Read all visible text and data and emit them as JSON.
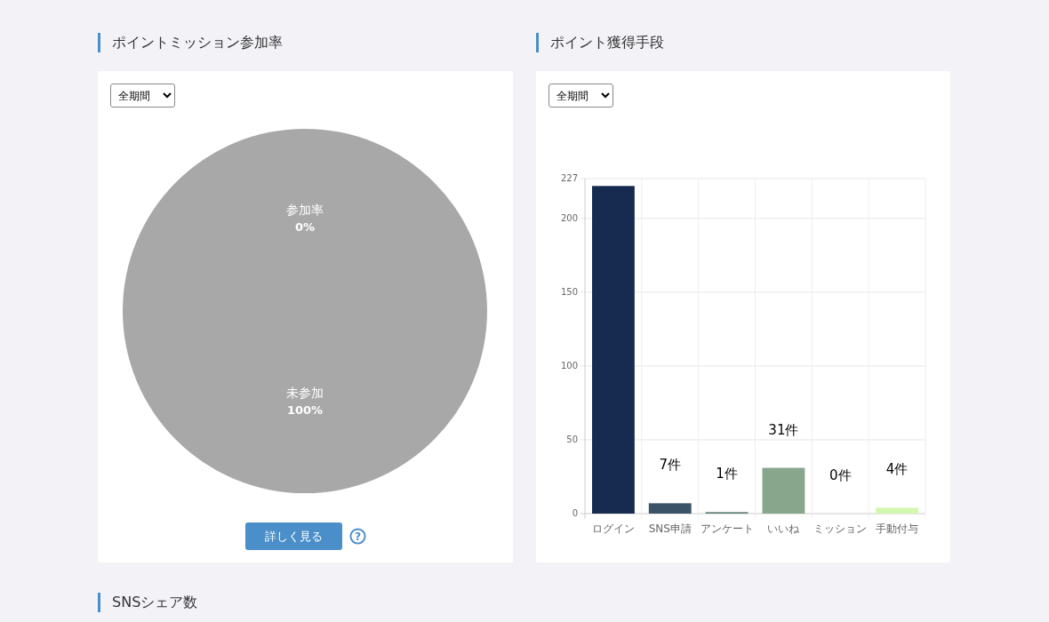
{
  "sections": [
    {
      "title": "ポイントミッション参加率",
      "period": {
        "value": "全期間"
      },
      "chart_data": {
        "type": "pie",
        "categories": [
          "参加率",
          "未参加"
        ],
        "series": [
          {
            "color": "#a8a8a8",
            "values": [
              0,
              100
            ]
          }
        ],
        "value_labels": [
          "0%",
          "100%"
        ]
      },
      "button": "詳しく見る",
      "help": "?"
    },
    {
      "title": "ポイント獲得手段",
      "period": {
        "value": "全期間"
      },
      "chart_data": {
        "type": "bar",
        "categories": [
          "ログイン",
          "SNS申請",
          "アンケート",
          "いいね",
          "ミッション",
          "手動付与"
        ],
        "grid": true,
        "series": [
          {
            "color": "#172a50",
            "values": [
              222,
              null,
              null,
              null,
              null,
              null
            ]
          },
          {
            "color": "#3a5366",
            "values": [
              null,
              7,
              null,
              null,
              null,
              null
            ]
          },
          {
            "color": "#5c7d72",
            "values": [
              null,
              null,
              1,
              null,
              null,
              null
            ]
          },
          {
            "color": "#87a68c",
            "values": [
              null,
              null,
              null,
              31,
              null,
              null
            ]
          },
          {
            "color": "#d4f7b0",
            "values": [
              null,
              null,
              null,
              null,
              null,
              4
            ]
          }
        ],
        "ylim": [
          0,
          227
        ],
        "yticks": [
          0,
          50,
          100,
          150,
          200,
          227
        ],
        "value_labels": [
          null,
          "7件",
          "1件",
          "31件",
          "0件",
          "4件"
        ]
      }
    },
    {
      "title": "SNSシェア数"
    }
  ]
}
